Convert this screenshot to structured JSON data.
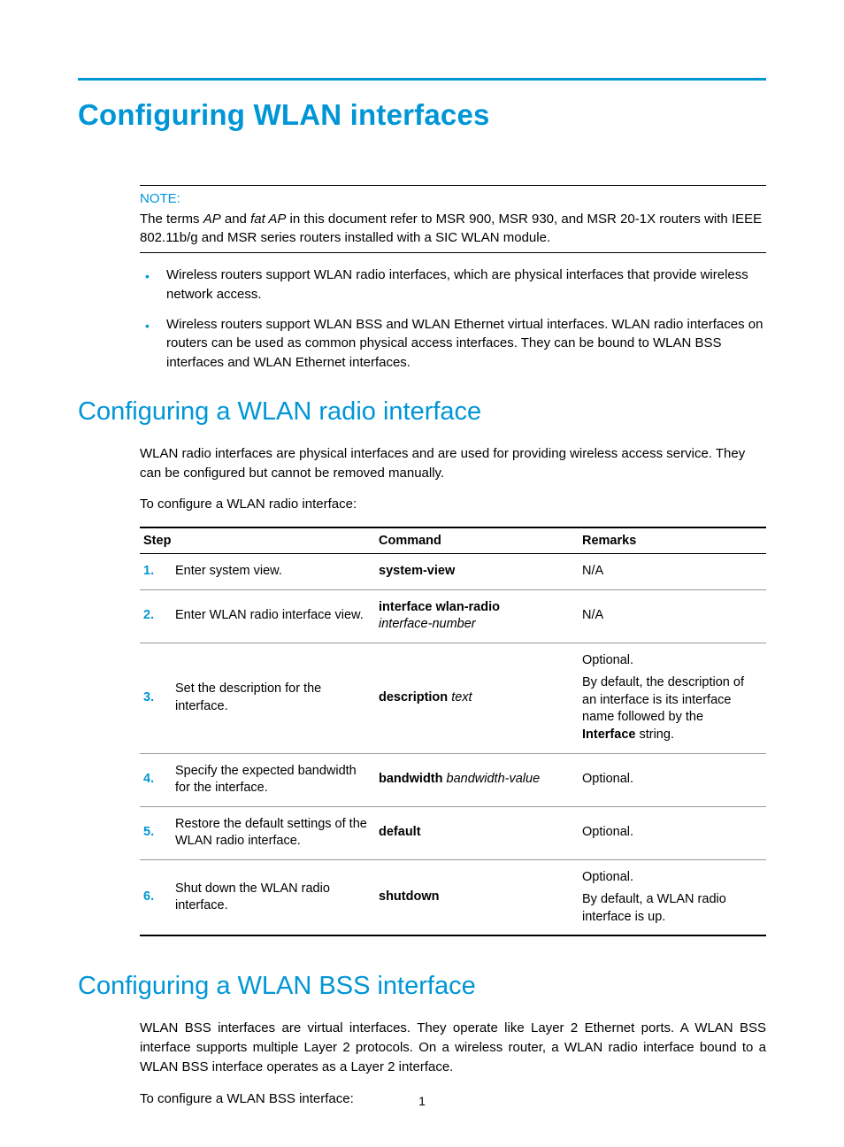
{
  "title": "Configuring WLAN interfaces",
  "note": {
    "label": "NOTE:",
    "body_pre": "The terms ",
    "ap": "AP",
    "body_mid1": " and ",
    "fat_ap": "fat AP",
    "body_post": " in this document refer to MSR 900, MSR 930, and MSR 20-1X routers with IEEE 802.11b/g and MSR series routers installed with a SIC WLAN module."
  },
  "bullets": [
    "Wireless routers support WLAN radio interfaces, which are physical interfaces that provide wireless network access.",
    "Wireless routers support WLAN BSS and WLAN Ethernet virtual interfaces. WLAN radio interfaces on routers can be used as common physical access interfaces. They can be bound to WLAN BSS interfaces and WLAN Ethernet interfaces."
  ],
  "section_radio": {
    "heading": "Configuring a WLAN radio interface",
    "intro": "WLAN radio interfaces are physical interfaces and are used for providing wireless access service. They can be configured but cannot be removed manually.",
    "lead_in": "To configure a WLAN radio interface:",
    "headers": {
      "step": "Step",
      "command": "Command",
      "remarks": "Remarks"
    },
    "rows": [
      {
        "n": "1.",
        "step": "Enter system view.",
        "cmd_bold": "system-view",
        "cmd_ital": "",
        "remarks_plain": "N/A"
      },
      {
        "n": "2.",
        "step": "Enter WLAN radio interface view.",
        "cmd_bold": "interface wlan-radio",
        "cmd_ital": "interface-number",
        "remarks_plain": "N/A"
      },
      {
        "n": "3.",
        "step": "Set the description for the interface.",
        "cmd_bold": "description",
        "cmd_ital": "text",
        "remarks_line1": "Optional.",
        "remarks_pre": "By default, the description of an interface is its interface name followed by the ",
        "remarks_bold": "Interface",
        "remarks_post": " string."
      },
      {
        "n": "4.",
        "step": "Specify the expected bandwidth for the interface.",
        "cmd_bold": "bandwidth",
        "cmd_ital": "bandwidth-value",
        "remarks_plain": "Optional."
      },
      {
        "n": "5.",
        "step": "Restore the default settings of the WLAN radio interface.",
        "cmd_bold": "default",
        "cmd_ital": "",
        "remarks_plain": "Optional."
      },
      {
        "n": "6.",
        "step": "Shut down the WLAN radio interface.",
        "cmd_bold": "shutdown",
        "cmd_ital": "",
        "remarks_line1": "Optional.",
        "remarks_line2": "By default, a WLAN radio interface is up."
      }
    ]
  },
  "section_bss": {
    "heading": "Configuring a WLAN BSS interface",
    "intro": "WLAN BSS interfaces are virtual interfaces. They operate like Layer 2 Ethernet ports. A WLAN BSS interface supports multiple Layer 2 protocols. On a wireless router, a WLAN radio interface bound to a WLAN BSS interface operates as a Layer 2 interface.",
    "lead_in": "To configure a WLAN BSS interface:"
  },
  "page_number": "1"
}
